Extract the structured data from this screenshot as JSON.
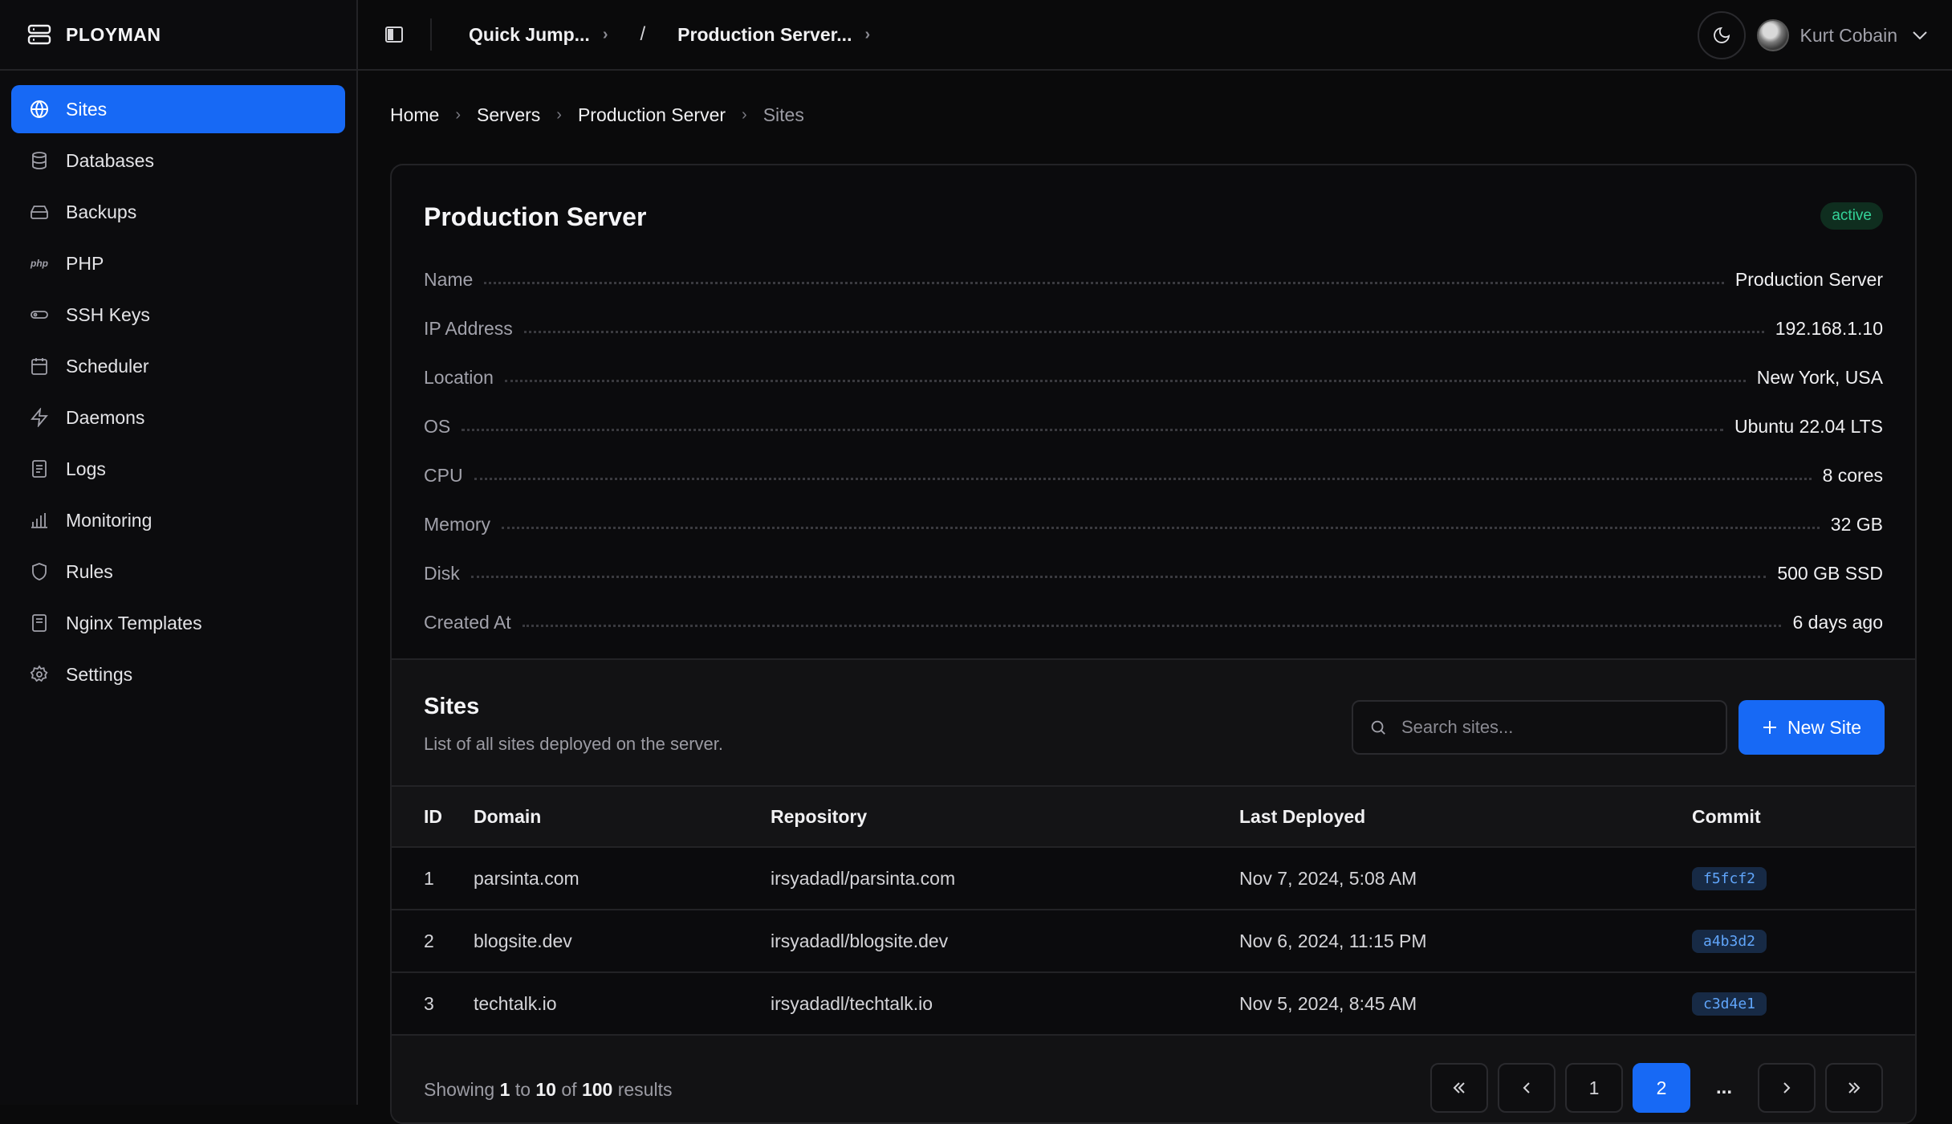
{
  "app": {
    "brand": "PLOYMAN"
  },
  "sidebar": {
    "items": [
      {
        "label": "Sites",
        "icon": "globe-icon",
        "active": true
      },
      {
        "label": "Databases",
        "icon": "database-icon"
      },
      {
        "label": "Backups",
        "icon": "hard-drive-icon"
      },
      {
        "label": "PHP",
        "icon": "php-icon"
      },
      {
        "label": "SSH Keys",
        "icon": "key-icon"
      },
      {
        "label": "Scheduler",
        "icon": "calendar-icon"
      },
      {
        "label": "Daemons",
        "icon": "bolt-icon"
      },
      {
        "label": "Logs",
        "icon": "file-text-icon"
      },
      {
        "label": "Monitoring",
        "icon": "bar-chart-icon"
      },
      {
        "label": "Rules",
        "icon": "shield-icon"
      },
      {
        "label": "Nginx Templates",
        "icon": "file-icon"
      },
      {
        "label": "Settings",
        "icon": "gear-icon"
      }
    ]
  },
  "topbar": {
    "quick_jump": "Quick Jump...",
    "separator": "/",
    "server_switch": "Production Server...",
    "user_name": "Kurt Cobain"
  },
  "breadcrumb": [
    "Home",
    "Servers",
    "Production Server",
    "Sites"
  ],
  "server": {
    "title": "Production Server",
    "status": "active",
    "details": [
      {
        "label": "Name",
        "value": "Production Server"
      },
      {
        "label": "IP Address",
        "value": "192.168.1.10"
      },
      {
        "label": "Location",
        "value": "New York, USA"
      },
      {
        "label": "OS",
        "value": "Ubuntu 22.04 LTS"
      },
      {
        "label": "CPU",
        "value": "8 cores"
      },
      {
        "label": "Memory",
        "value": "32 GB"
      },
      {
        "label": "Disk",
        "value": "500 GB SSD"
      },
      {
        "label": "Created At",
        "value": "6 days ago"
      }
    ]
  },
  "sites": {
    "title": "Sites",
    "subtitle": "List of all sites deployed on the server.",
    "search_placeholder": "Search sites...",
    "new_button": "New Site",
    "columns": [
      "ID",
      "Domain",
      "Repository",
      "Last Deployed",
      "Commit"
    ],
    "rows": [
      {
        "id": "1",
        "domain": "parsinta.com",
        "repo": "irsyadadl/parsinta.com",
        "deployed": "Nov 7, 2024, 5:08 AM",
        "commit": "f5fcf2"
      },
      {
        "id": "2",
        "domain": "blogsite.dev",
        "repo": "irsyadadl/blogsite.dev",
        "deployed": "Nov 6, 2024, 11:15 PM",
        "commit": "a4b3d2"
      },
      {
        "id": "3",
        "domain": "techtalk.io",
        "repo": "irsyadadl/techtalk.io",
        "deployed": "Nov 5, 2024, 8:45 AM",
        "commit": "c3d4e1"
      }
    ],
    "pagination": {
      "showing_prefix": "Showing",
      "from": "1",
      "to_word": "to",
      "to": "10",
      "of_word": "of",
      "total": "100",
      "suffix": "results",
      "pages": [
        "1",
        "2"
      ],
      "current_page": "2",
      "ellipsis": "..."
    }
  },
  "colors": {
    "accent": "#1769f5",
    "status_active": "#34d399",
    "commit": "#60a5fa"
  }
}
